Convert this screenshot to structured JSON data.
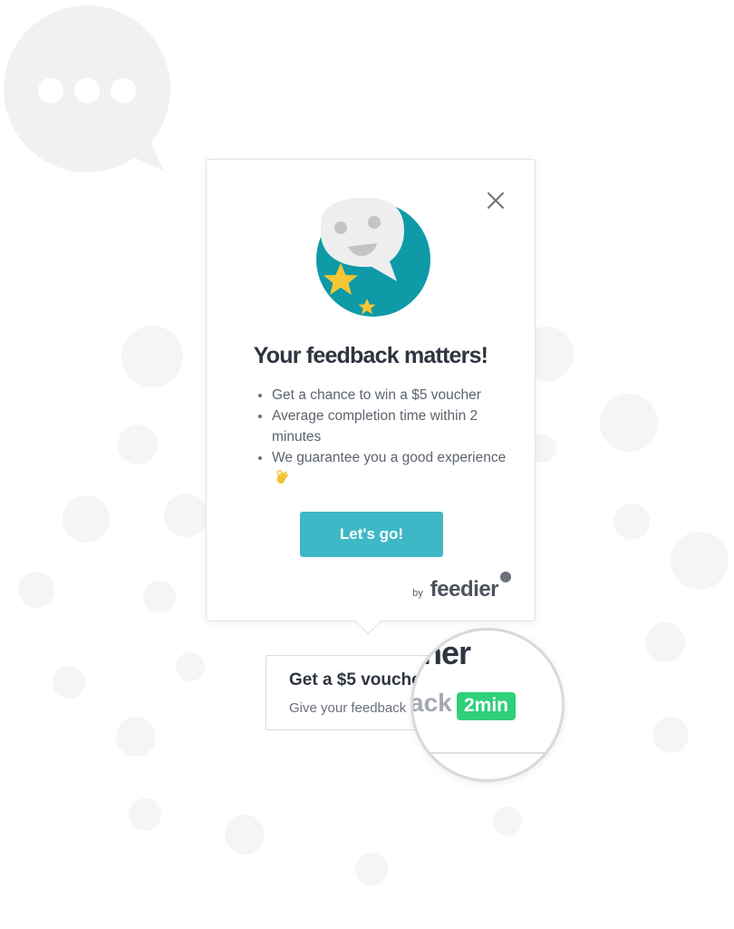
{
  "popup": {
    "title": "Your feedback matters!",
    "bullets": [
      "Get a chance to win a $5 voucher",
      "Average completion time within 2 minutes",
      "We guarantee you a good experience"
    ],
    "cta_label": "Let's go!",
    "byline_prefix": "by",
    "brand_name": "feedier"
  },
  "widget": {
    "title": "Get a $5 voucher",
    "subtitle": "Give your feedback"
  },
  "magnifier": {
    "title_fragment": "her",
    "subtitle_fragment": "ack",
    "badge": "2min"
  },
  "icons": {
    "close": "close-icon",
    "hero": "smiling-speech-bubble-with-stars-illustration",
    "ok_hand": "ok-hand-icon",
    "background": "speech-bubble-icons"
  },
  "colors": {
    "accent": "#3eb8c6",
    "hero_teal": "#0e9aa7",
    "star": "#f6c634",
    "badge_green": "#2fd07a",
    "title_text": "#2e3540"
  }
}
